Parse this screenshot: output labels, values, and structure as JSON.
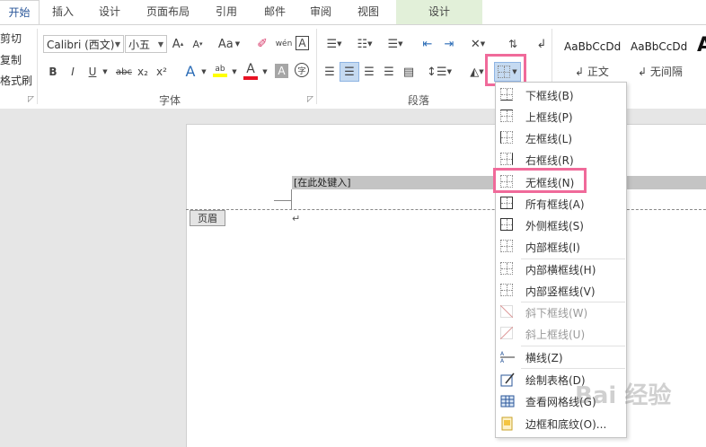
{
  "tabs": [
    {
      "label": "开始",
      "active": true
    },
    {
      "label": "插入"
    },
    {
      "label": "设计"
    },
    {
      "label": "页面布局"
    },
    {
      "label": "引用"
    },
    {
      "label": "邮件"
    },
    {
      "label": "审阅"
    },
    {
      "label": "视图"
    },
    {
      "label": "设计",
      "contextual": true
    }
  ],
  "clipboard": {
    "cut": "剪切",
    "copy": "复制",
    "format_painter": "格式刷"
  },
  "font": {
    "name": "Calibri (西文)",
    "size": "小五",
    "group_label": "字体",
    "bold": "B",
    "italic": "I",
    "underline": "U",
    "strike": "abc",
    "sub": "x₂",
    "sup": "x²",
    "grow": "A",
    "shrink": "A",
    "case": "Aa",
    "phonetic": "wén",
    "char_border": "A",
    "char_shade": "A",
    "enclose": "字",
    "text_effect": "A",
    "highlight": "ab",
    "font_color": "A"
  },
  "paragraph": {
    "group_label": "段落"
  },
  "styles": {
    "items": [
      {
        "preview": "AaBbCcDd",
        "name": "正文"
      },
      {
        "preview": "AaBbCcDd",
        "name": "无间隔"
      },
      {
        "preview": "A",
        "name": ""
      }
    ]
  },
  "document": {
    "header_placeholder": "[在此处键入]",
    "header_tag": "页眉",
    "paragraph_mark": "↵"
  },
  "border_menu": {
    "items": [
      {
        "label": "下框线(B)",
        "icon": "bottom-border-icon",
        "disabled": false
      },
      {
        "label": "上框线(P)",
        "icon": "top-border-icon",
        "disabled": false
      },
      {
        "label": "左框线(L)",
        "icon": "left-border-icon",
        "disabled": false
      },
      {
        "label": "右框线(R)",
        "icon": "right-border-icon",
        "disabled": false
      },
      {
        "label": "无框线(N)",
        "icon": "no-border-icon",
        "disabled": false,
        "highlighted": true
      },
      {
        "label": "所有框线(A)",
        "icon": "all-borders-icon",
        "disabled": false
      },
      {
        "label": "外侧框线(S)",
        "icon": "outside-borders-icon",
        "disabled": false
      },
      {
        "label": "内部框线(I)",
        "icon": "inside-borders-icon",
        "disabled": false
      },
      {
        "label": "内部横框线(H)",
        "icon": "inside-horizontal-border-icon",
        "disabled": false
      },
      {
        "label": "内部竖框线(V)",
        "icon": "inside-vertical-border-icon",
        "disabled": false
      },
      {
        "label": "斜下框线(W)",
        "icon": "diagonal-down-border-icon",
        "disabled": true
      },
      {
        "label": "斜上框线(U)",
        "icon": "diagonal-up-border-icon",
        "disabled": true
      },
      {
        "label": "横线(Z)",
        "icon": "horizontal-line-icon",
        "disabled": false
      },
      {
        "label": "绘制表格(D)",
        "icon": "draw-table-icon",
        "disabled": false
      },
      {
        "label": "查看网格线(G)",
        "icon": "view-gridlines-icon",
        "disabled": false
      },
      {
        "label": "边框和底纹(O)...",
        "icon": "borders-shading-icon",
        "disabled": false
      }
    ]
  },
  "watermark": {
    "text": "Bai 经验"
  },
  "colors": {
    "highlight": "#f06a9a",
    "accent": "#2b579a",
    "font_color_bar": "#e81123",
    "highlight_bar": "#ffff00"
  }
}
